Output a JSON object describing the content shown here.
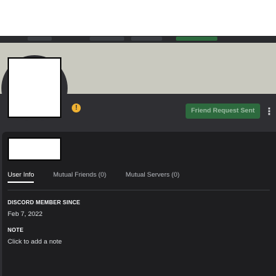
{
  "header": {
    "friend_request_label": "Friend Request Sent",
    "more_icon": "⋮",
    "status_icon": "!"
  },
  "tabs": [
    {
      "label": "User Info",
      "active": true
    },
    {
      "label": "Mutual Friends (0)",
      "active": false
    },
    {
      "label": "Mutual Servers (0)",
      "active": false
    }
  ],
  "user_info": {
    "member_since_label": "DISCORD MEMBER SINCE",
    "member_since_value": "Feb 7, 2022",
    "note_label": "NOTE",
    "note_placeholder": "Click to add a note"
  },
  "colors": {
    "banner": "#c9c9bf",
    "profile_bg": "#2f2f33",
    "panel_bg": "#1e1e20",
    "friend_button": "#2d6a3e",
    "status_warning": "#f0b232"
  },
  "icons": {
    "status": "warning-icon",
    "more": "more-options-icon"
  }
}
